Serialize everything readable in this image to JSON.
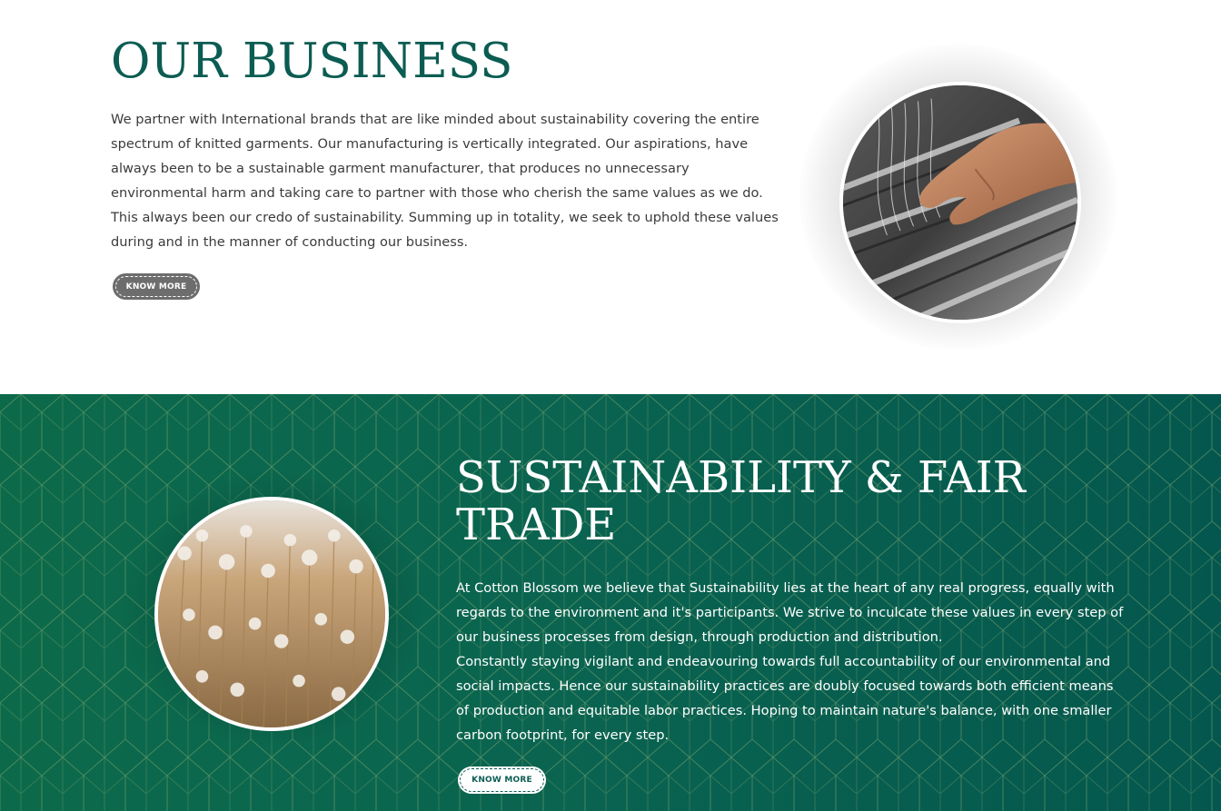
{
  "business": {
    "title": "OUR BUSINESS",
    "body": "We partner with International brands that are like minded about sustainability covering the entire spectrum of knitted garments. Our manufacturing is vertically integrated. Our aspirations, have always been to be a sustainable garment manufacturer, that produces no unnecessary environmental harm and taking care to partner with those who cherish the same values as we do. This always been our credo of sustainability. Summing up in totality, we seek to uphold these values during and in the manner of conducting our business.",
    "button_label": "KNOW MORE",
    "photo_icon": "knitting-machine-photo"
  },
  "sustainability": {
    "title": "SUSTAINABILITY & FAIR TRADE",
    "paragraph_1": "At Cotton Blossom we believe that Sustainability lies at the heart of any real progress, equally with regards to the environment and it's participants. We strive to inculcate these values in every step of our business processes from design, through production and distribution.",
    "paragraph_2": "Constantly staying vigilant and endeavouring towards full accountability of our environmental and social impacts. Hence our sustainability practices are doubly focused towards both efficient means of production and equitable labor practices. Hoping to maintain nature's balance, with one smaller carbon footprint, for every step.",
    "button_label": "KNOW MORE",
    "photo_icon": "cotton-field-photo"
  },
  "colors": {
    "brand_green": "#0b5c52",
    "section_green": "#0a6450",
    "button_gray": "#6d6d6d"
  }
}
